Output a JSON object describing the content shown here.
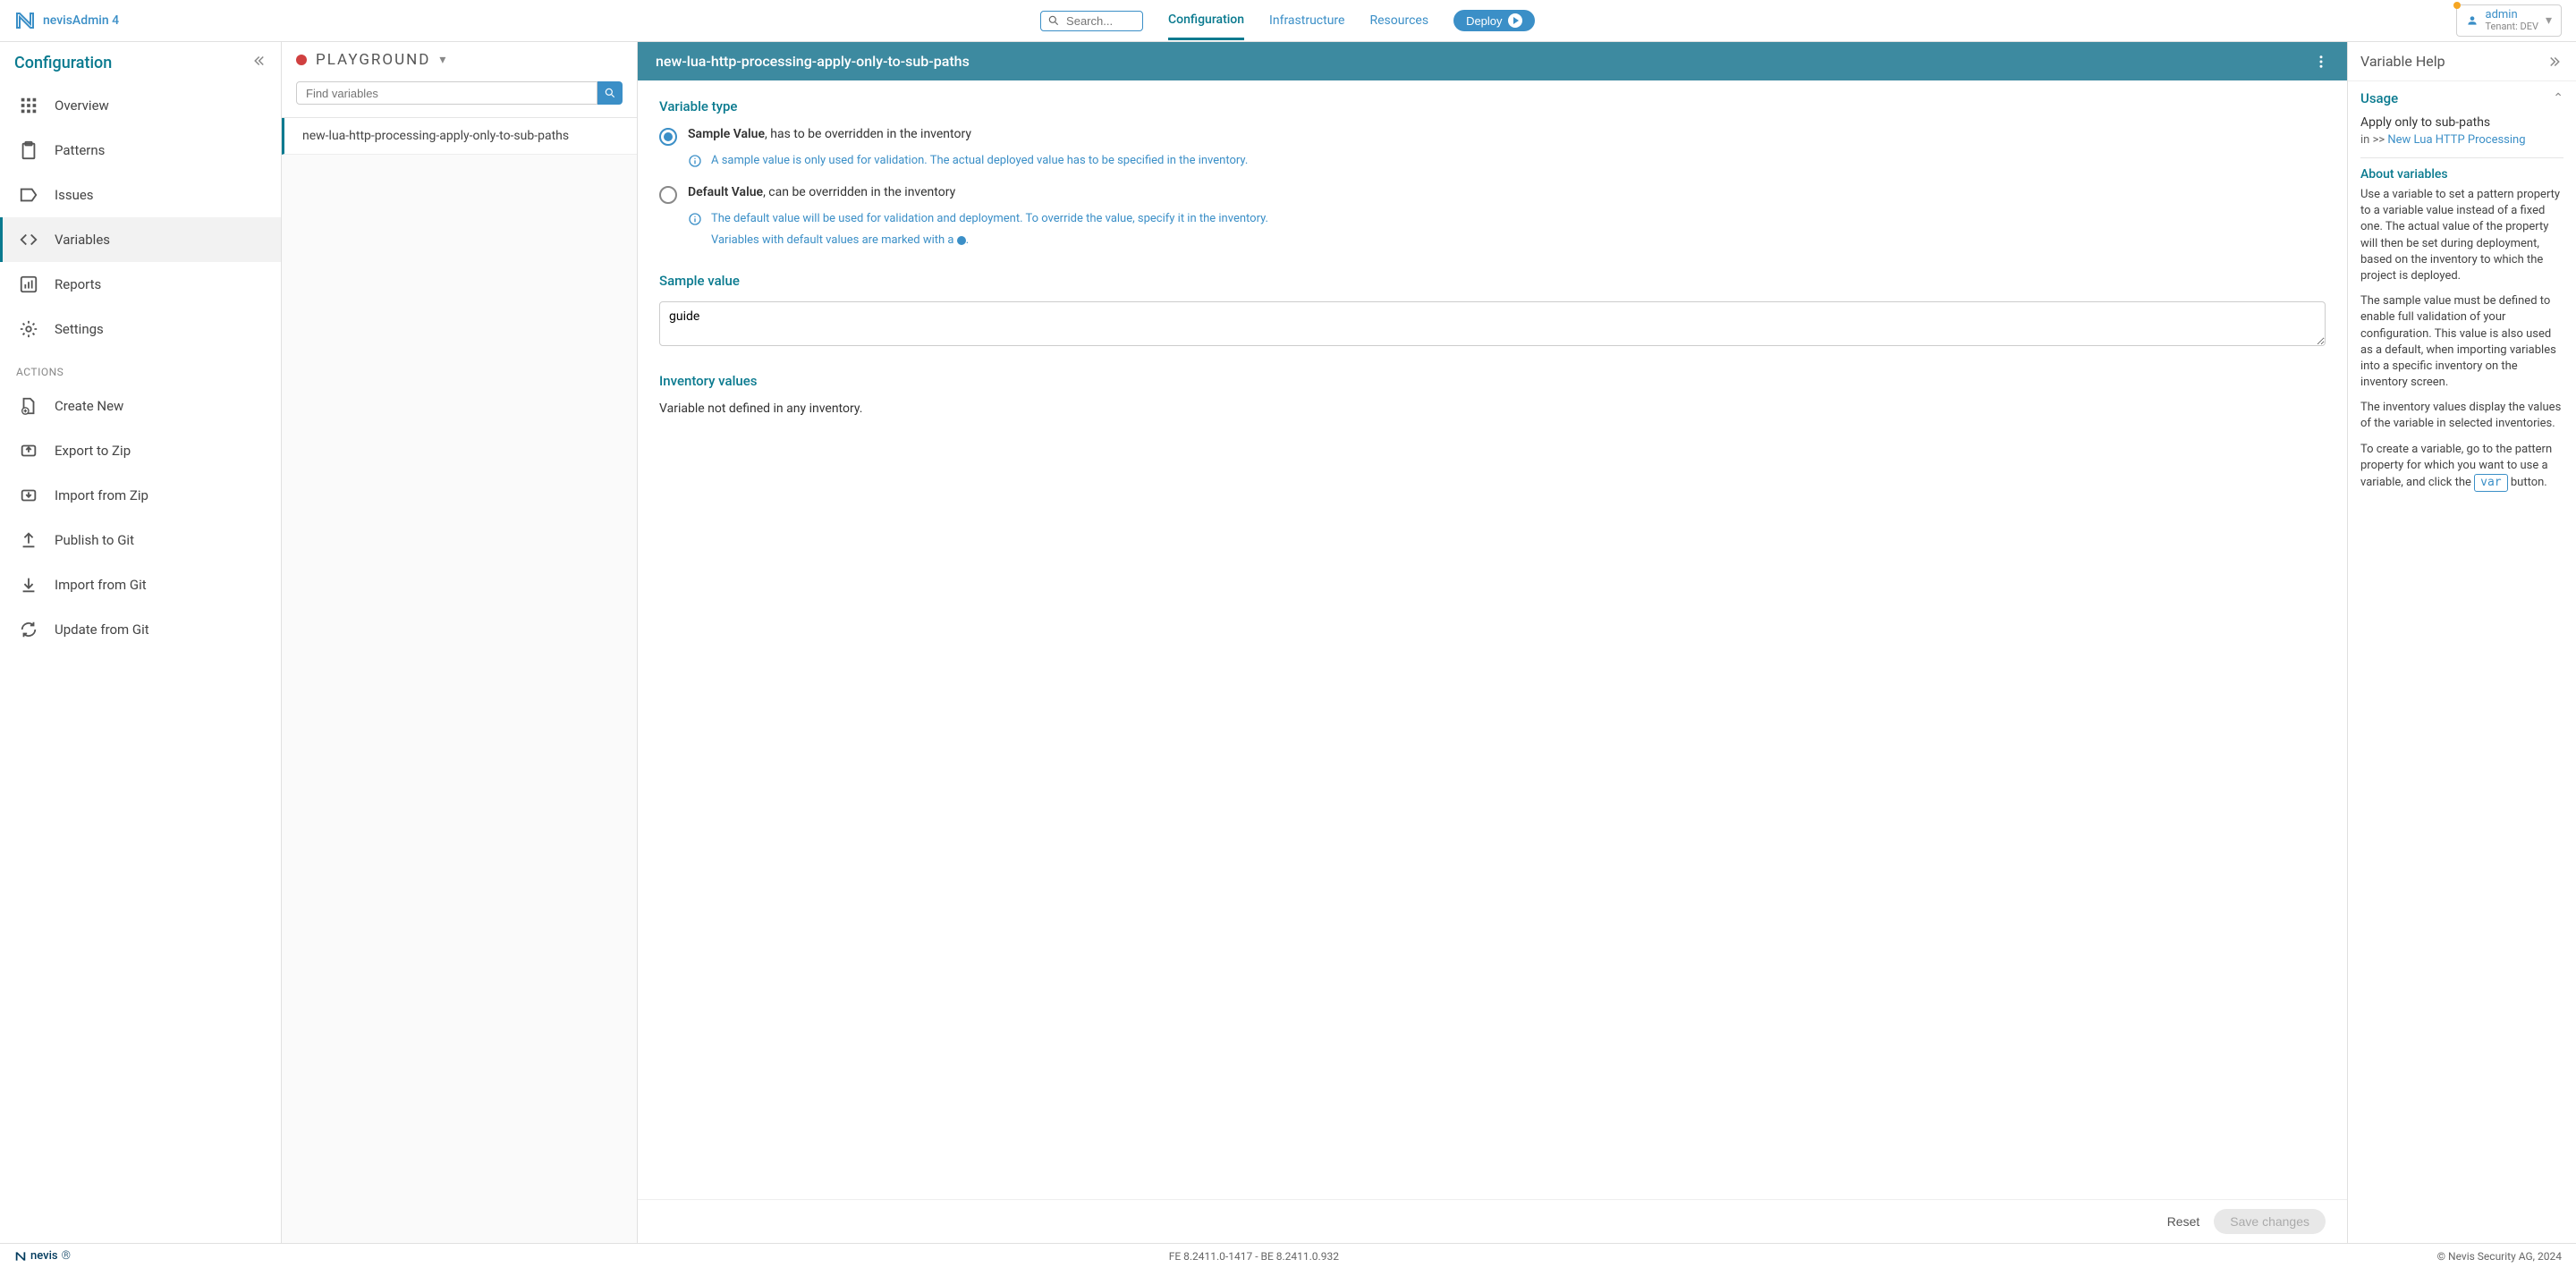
{
  "app": {
    "name": "nevisAdmin 4"
  },
  "search": {
    "placeholder": "Search..."
  },
  "nav": {
    "configuration": "Configuration",
    "infrastructure": "Infrastructure",
    "resources": "Resources",
    "deploy": "Deploy"
  },
  "user": {
    "name": "admin",
    "tenant": "Tenant: DEV"
  },
  "sidebar": {
    "title": "Configuration",
    "items": {
      "overview": "Overview",
      "patterns": "Patterns",
      "issues": "Issues",
      "variables": "Variables",
      "reports": "Reports",
      "settings": "Settings"
    },
    "actions_label": "ACTIONS",
    "actions": {
      "create": "Create New",
      "export": "Export to Zip",
      "importzip": "Import from Zip",
      "publish": "Publish to Git",
      "importgit": "Import from Git",
      "updategit": "Update from Git"
    }
  },
  "varpanel": {
    "project": "PLAYGROUND",
    "find_placeholder": "Find variables",
    "list": {
      "item0": "new-lua-http-processing-apply-only-to-sub-paths"
    }
  },
  "detail": {
    "title": "new-lua-http-processing-apply-only-to-sub-paths",
    "type_heading": "Variable type",
    "sample_label_b": "Sample Value",
    "sample_label_rest": ", has to be overridden in the inventory",
    "sample_info": "A sample value is only used for validation. The actual deployed value has to be specified in the inventory.",
    "default_label_b": "Default Value",
    "default_label_rest": ", can be overridden in the inventory",
    "default_info1": "The default value will be used for validation and deployment. To override the value, specify it in the inventory.",
    "default_info2_pre": "Variables with default values are marked with a ",
    "default_info2_post": ".",
    "sample_value_heading": "Sample value",
    "sample_value": "guide",
    "inventory_heading": "Inventory values",
    "inventory_text": "Variable not defined in any inventory.",
    "reset": "Reset",
    "save": "Save changes"
  },
  "help": {
    "title": "Variable Help",
    "usage": "Usage",
    "var_title": "Apply only to sub-paths",
    "crumb_pre": "in >> ",
    "crumb_link": "New Lua HTTP Processing",
    "about": "About variables",
    "p1": "Use a variable to set a pattern property to a variable value instead of a fixed one. The actual value of the property will then be set during deployment, based on the inventory to which the project is deployed.",
    "p2": "The sample value must be defined to enable full validation of your configuration. This value is also used as a default, when importing variables into a specific inventory on the inventory screen.",
    "p3": "The inventory values display the values of the variable in selected inventories.",
    "p4_pre": "To create a variable, go to the pattern property for which you want to use a variable, and click the ",
    "p4_chip": "var",
    "p4_post": " button."
  },
  "footer": {
    "brand": "nevis",
    "version": "FE 8.2411.0-1417 - BE 8.2411.0.932",
    "copyright": "© Nevis Security AG, 2024"
  }
}
